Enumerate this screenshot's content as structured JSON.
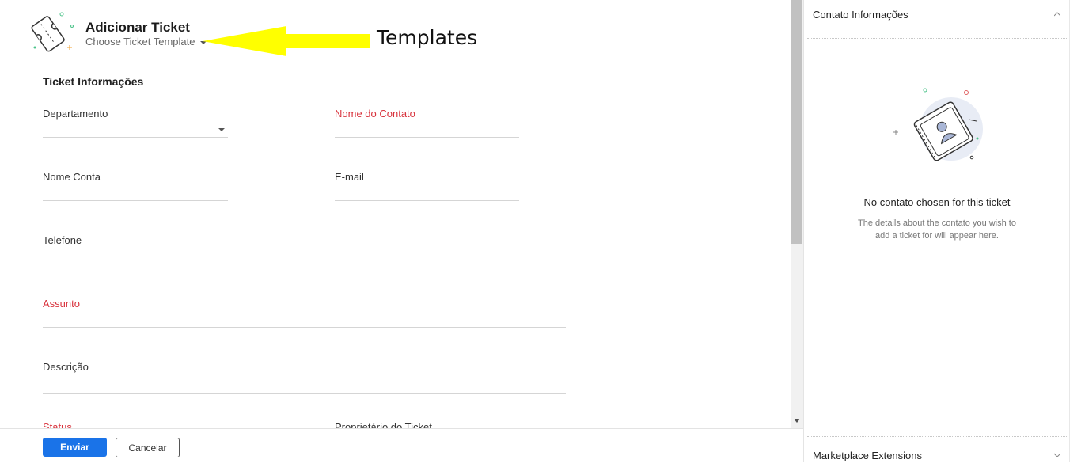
{
  "header": {
    "title": "Adicionar Ticket",
    "template_label": "Choose Ticket Template"
  },
  "annotation": {
    "text": "Templates"
  },
  "form": {
    "section_title": "Ticket Informações",
    "fields": {
      "departamento": "Departamento",
      "nome_contato": "Nome do Contato",
      "nome_conta": "Nome Conta",
      "email": "E-mail",
      "telefone": "Telefone",
      "assunto": "Assunto",
      "descricao": "Descrição",
      "status": "Status",
      "proprietario": "Proprietário do Ticket"
    }
  },
  "footer": {
    "submit_label": "Enviar",
    "cancel_label": "Cancelar"
  },
  "sidebar": {
    "contact_title": "Contato Informações",
    "empty_title": "No contato chosen for this ticket",
    "empty_desc": "The details about the contato you wish to add a ticket for will appear here.",
    "marketplace_title": "Marketplace Extensions"
  },
  "colors": {
    "primary": "#1a73e8",
    "required": "#d8323c",
    "annotation": "#ffff00"
  }
}
